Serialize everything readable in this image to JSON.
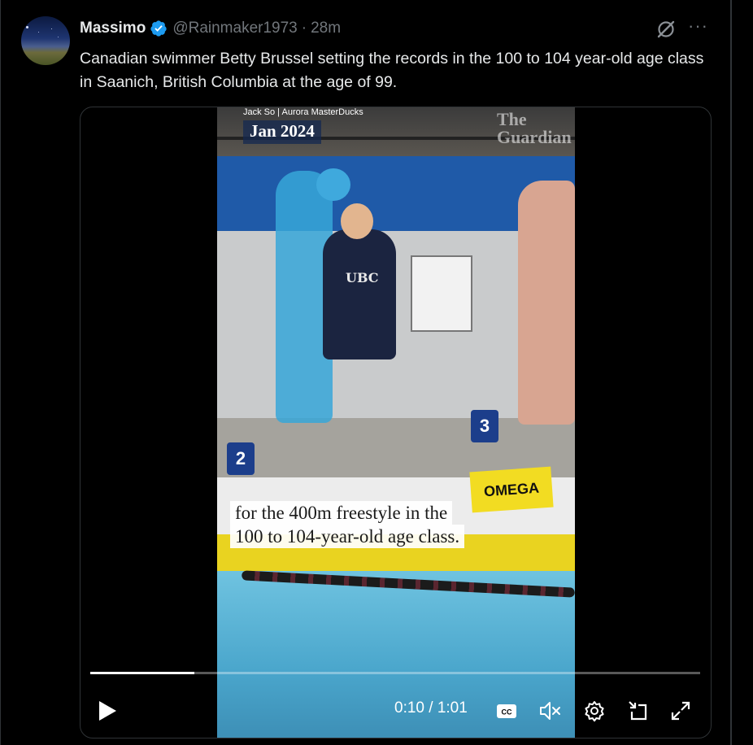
{
  "tweet": {
    "author_name": "Massimo",
    "handle": "@Rainmaker1973",
    "separator": "·",
    "time": "28m",
    "text": "Canadian swimmer Betty Brussel setting the records in the 100 to 104 year-old age class in Saanich, British Columbia at the age of 99."
  },
  "icons": {
    "verified": "verified-badge-icon",
    "grok": "grok-icon",
    "more": "more-icon",
    "more_glyph": "···"
  },
  "video": {
    "credit": "Jack So | Aurora MasterDucks",
    "date_tag": "Jan 2024",
    "watermark_line1": "The",
    "watermark_line2": "Guardian",
    "sign_ubc": "UBC",
    "sign_omega": "OMEGA",
    "lane_2": "2",
    "lane_3": "3",
    "caption_line1": "for the 400m freestyle in the",
    "caption_line2": "100 to 104-year-old age class.",
    "current_time": "0:10",
    "time_sep": " / ",
    "duration": "1:01",
    "progress": 0.17,
    "cc_label": "CC"
  },
  "colors": {
    "background": "#000000",
    "text_primary": "#e7e9ea",
    "text_secondary": "#71767b",
    "verified_blue": "#1d9bf0",
    "border": "#2f3336"
  }
}
